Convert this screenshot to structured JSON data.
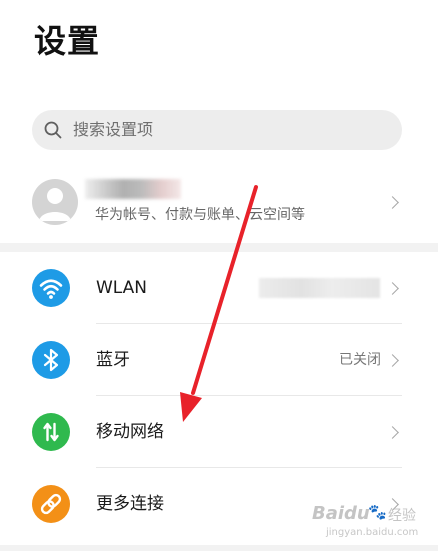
{
  "header": {
    "title": "设置"
  },
  "search": {
    "placeholder": "搜索设置项",
    "icon": "search-icon"
  },
  "account": {
    "subtitle": "华为帐号、付款与账单、云空间等",
    "icon": "avatar"
  },
  "settings": {
    "items": [
      {
        "label": "WLAN",
        "value": "",
        "icon": "wifi-icon",
        "icon_color": "#1e9be6"
      },
      {
        "label": "蓝牙",
        "value": "已关闭",
        "icon": "bluetooth-icon",
        "icon_color": "#1e9be6"
      },
      {
        "label": "移动网络",
        "value": "",
        "icon": "mobile-data-icon",
        "icon_color": "#2fb94e"
      },
      {
        "label": "更多连接",
        "value": "",
        "icon": "link-icon",
        "icon_color": "#f39017"
      }
    ]
  },
  "annotation": {
    "arrow_color": "#e8222a"
  },
  "watermark": {
    "brand": "Baidu",
    "suffix": "经验",
    "domain": "jingyan.baidu.com"
  }
}
